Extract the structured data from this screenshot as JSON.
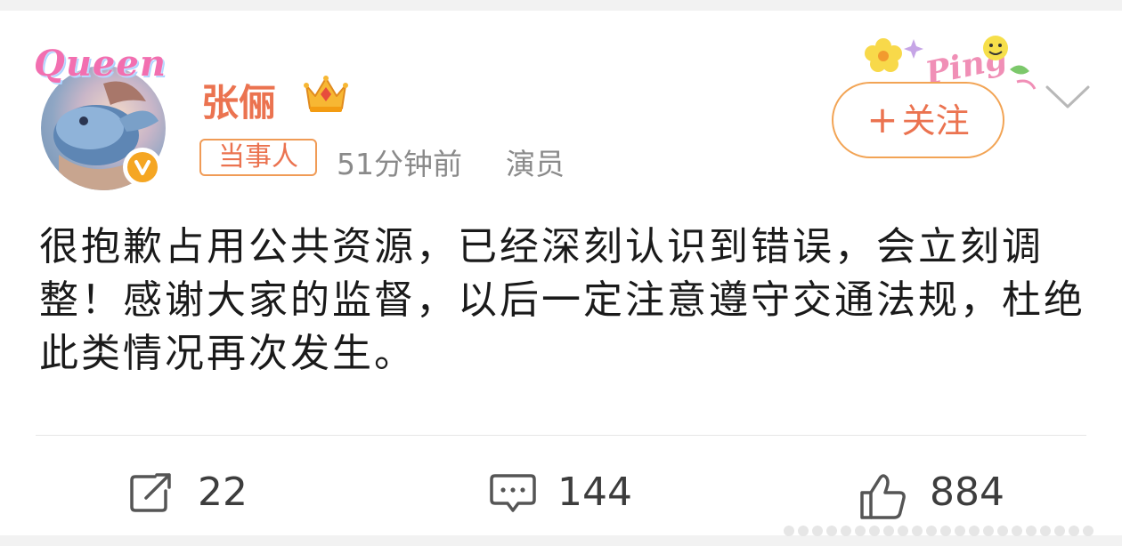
{
  "post": {
    "avatar_overlay_text": "Queen",
    "author": "张俪",
    "tag": "当事人",
    "time": "51分钟前",
    "source": "演员",
    "follow": {
      "plus": "+",
      "label": "关注"
    },
    "text": "很抱歉占用公共资源，已经深刻认识到错误，会立刻调整！感谢大家的监督，以后一定注意遵守交通法规，杜绝此类情况再次发生。",
    "decoration_text": "Ping"
  },
  "actions": {
    "repost_count": "22",
    "comment_count": "144",
    "like_count": "884"
  },
  "colors": {
    "accent": "#eb7350",
    "verified": "#f5a623",
    "meta": "#8a8a8a"
  },
  "icons": [
    "crown-icon",
    "verified-icon",
    "chevron-down-icon",
    "repost-icon",
    "comment-icon",
    "like-icon"
  ]
}
